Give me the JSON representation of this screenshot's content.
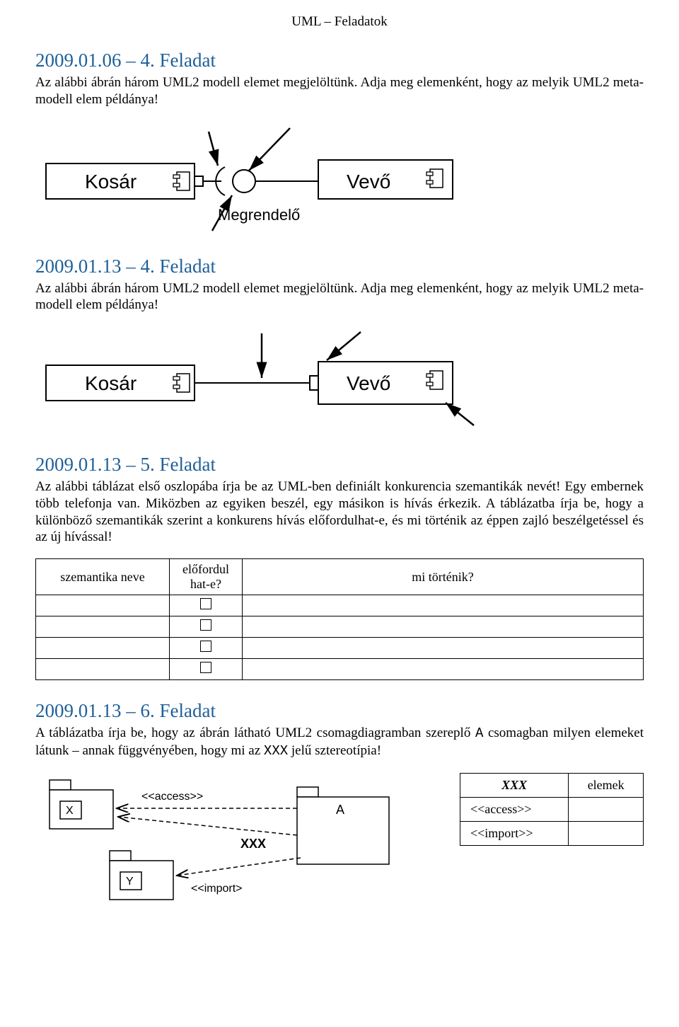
{
  "header": "UML – Feladatok",
  "task1": {
    "title": "2009.01.06 – 4. Feladat",
    "body": "Az alábbi ábrán három UML2 modell elemet megjelöltünk. Adja meg elemenként, hogy az melyik UML2 meta-modell elem példánya!",
    "labels": {
      "kosar": "Kosár",
      "vevo": "Vevő",
      "megrendelo": "Megrendelő"
    }
  },
  "task2": {
    "title": "2009.01.13 – 4. Feladat",
    "body": "Az alábbi ábrán három UML2 modell elemet megjelöltünk. Adja meg elemenként, hogy az melyik UML2 meta-modell elem példánya!",
    "labels": {
      "kosar": "Kosár",
      "vevo": "Vevő"
    }
  },
  "task3": {
    "title": "2009.01.13 – 5. Feladat",
    "body": "Az alábbi táblázat első oszlopába írja be az UML-ben definiált konkurencia szemantikák nevét! Egy embernek több telefonja van. Miközben az egyiken beszél, egy másikon is hívás érkezik. A táblázatba írja be, hogy a különböző szemantikák szerint a konkurens hívás előfordulhat-e, és mi történik az éppen zajló beszélgetéssel és az új hívással!",
    "table": {
      "col1": "szemantika neve",
      "col2": "előfordul hat-e?",
      "col3": "mi történik?"
    }
  },
  "task4": {
    "title": "2009.01.13 – 6. Feladat",
    "body_pre": "A táblázatba írja be, hogy az ábrán látható UML2 csomagdiagramban szereplő ",
    "body_mono1": "A",
    "body_mid": " csomagban milyen elemeket látunk – annak függvényében, hogy mi az ",
    "body_mono2": "XXX",
    "body_post": " jelű sztereotípia!",
    "labels": {
      "x": "X",
      "y": "Y",
      "a": "A",
      "access": "<<access>>",
      "xxx": "XXX",
      "import": "<<import>"
    },
    "table": {
      "h1": "XXX",
      "h2": "elemek",
      "r1": "<<access>>",
      "r2": "<<import>>"
    }
  }
}
